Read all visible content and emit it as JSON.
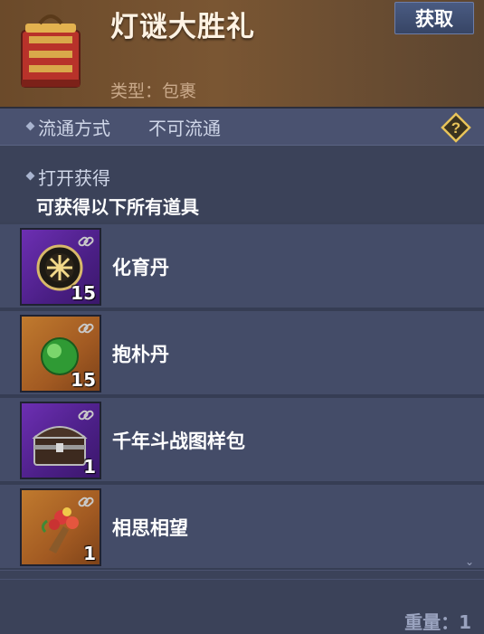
{
  "header": {
    "title": "灯谜大胜礼",
    "type_line": "类型：包裹",
    "get_button": "获取",
    "icon": "gift-box-icon"
  },
  "circulation": {
    "label": "流通方式",
    "value": "不可流通",
    "help_icon": "question-diamond-icon"
  },
  "open": {
    "label": "打开获得",
    "description": "可获得以下所有道具"
  },
  "items": [
    {
      "name": "化育丹",
      "qty": "15",
      "rarity": "purple",
      "icon": "dark-orb-icon"
    },
    {
      "name": "抱朴丹",
      "qty": "15",
      "rarity": "orange",
      "icon": "green-orb-icon"
    },
    {
      "name": "千年斗战图样包",
      "qty": "1",
      "rarity": "purple",
      "icon": "treasure-chest-icon"
    },
    {
      "name": "相思相望",
      "qty": "1",
      "rarity": "orange",
      "icon": "flower-bouquet-icon"
    }
  ],
  "footer": {
    "weight": "重量：1"
  },
  "colors": {
    "header_bg": "#7a5633",
    "panel_bg": "#3a4157",
    "purple_rarity": "#6d2fb3",
    "orange_rarity": "#c07a2e"
  }
}
